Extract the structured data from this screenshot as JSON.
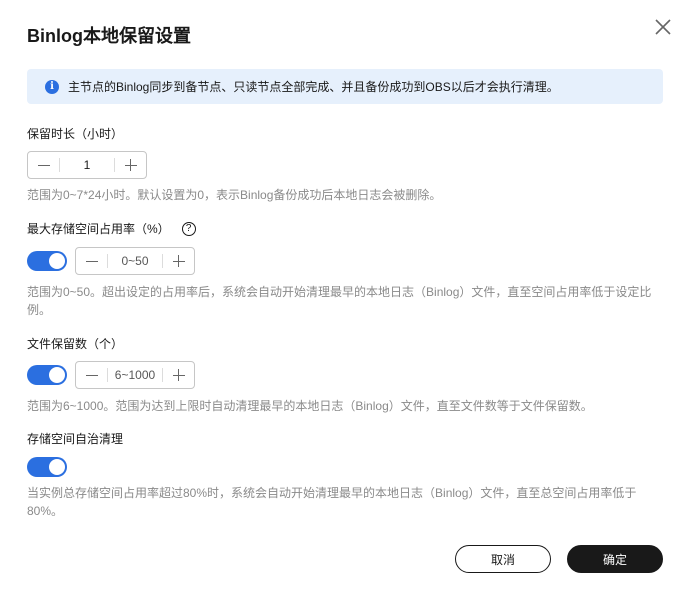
{
  "dialog": {
    "title": "Binlog本地保留设置",
    "close_icon": "close-icon"
  },
  "info": {
    "icon": "info-icon",
    "text": "主节点的Binlog同步到备节点、只读节点全部完成、并且备份成功到OBS以后才会执行清理。"
  },
  "retention_hours": {
    "label": "保留时长（小时）",
    "value": "1",
    "description": "范围为0~7*24小时。默认设置为0，表示Binlog备份成功后本地日志会被删除。"
  },
  "max_storage_usage": {
    "label": "最大存储空间占用率（%）",
    "help_icon": "question-mark",
    "enabled": true,
    "placeholder": "0~50",
    "description": "范围为0~50。超出设定的占用率后，系统会自动开始清理最早的本地日志（Binlog）文件，直至空间占用率低于设定比例。"
  },
  "file_retention_count": {
    "label": "文件保留数（个）",
    "enabled": true,
    "placeholder": "6~1000",
    "description": "范围为6~1000。范围为达到上限时自动清理最早的本地日志（Binlog）文件，直至文件数等于文件保留数。"
  },
  "auto_cleanup": {
    "label": "存储空间自治清理",
    "enabled": true,
    "description": "当实例总存储空间占用率超过80%时，系统会自动开始清理最早的本地日志（Binlog）文件，直至总空间占用率低于80%。"
  },
  "footer": {
    "cancel_label": "取消",
    "ok_label": "确定"
  },
  "colors": {
    "accent": "#2b6fe0",
    "info_bg": "#e6f0fc",
    "primary_button": "#191919",
    "muted_text": "#8a8a8a"
  }
}
